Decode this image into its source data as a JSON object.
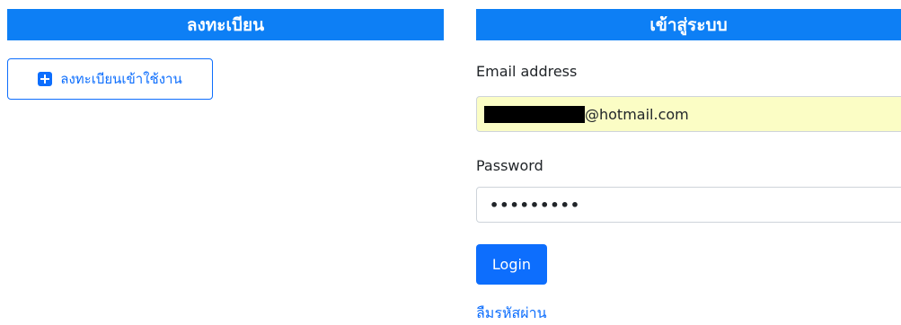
{
  "register_panel": {
    "title": "ลงทะเบียน",
    "register_button_label": "ลงทะเบียนเข้าใช้งาน",
    "icon": "plus-square-icon"
  },
  "login_panel": {
    "title": "เข้าสู่ระบบ",
    "email_label": "Email address",
    "email_value_visible": "@hotmail.com",
    "password_label": "Password",
    "password_mask": "•••••••••",
    "login_button_label": "Login",
    "forgot_password_link": "ลืมรหัสผ่าน"
  },
  "colors": {
    "header_bg": "#0d7ff5",
    "primary": "#0d6efd",
    "autofill_bg": "#fbfdc5"
  }
}
